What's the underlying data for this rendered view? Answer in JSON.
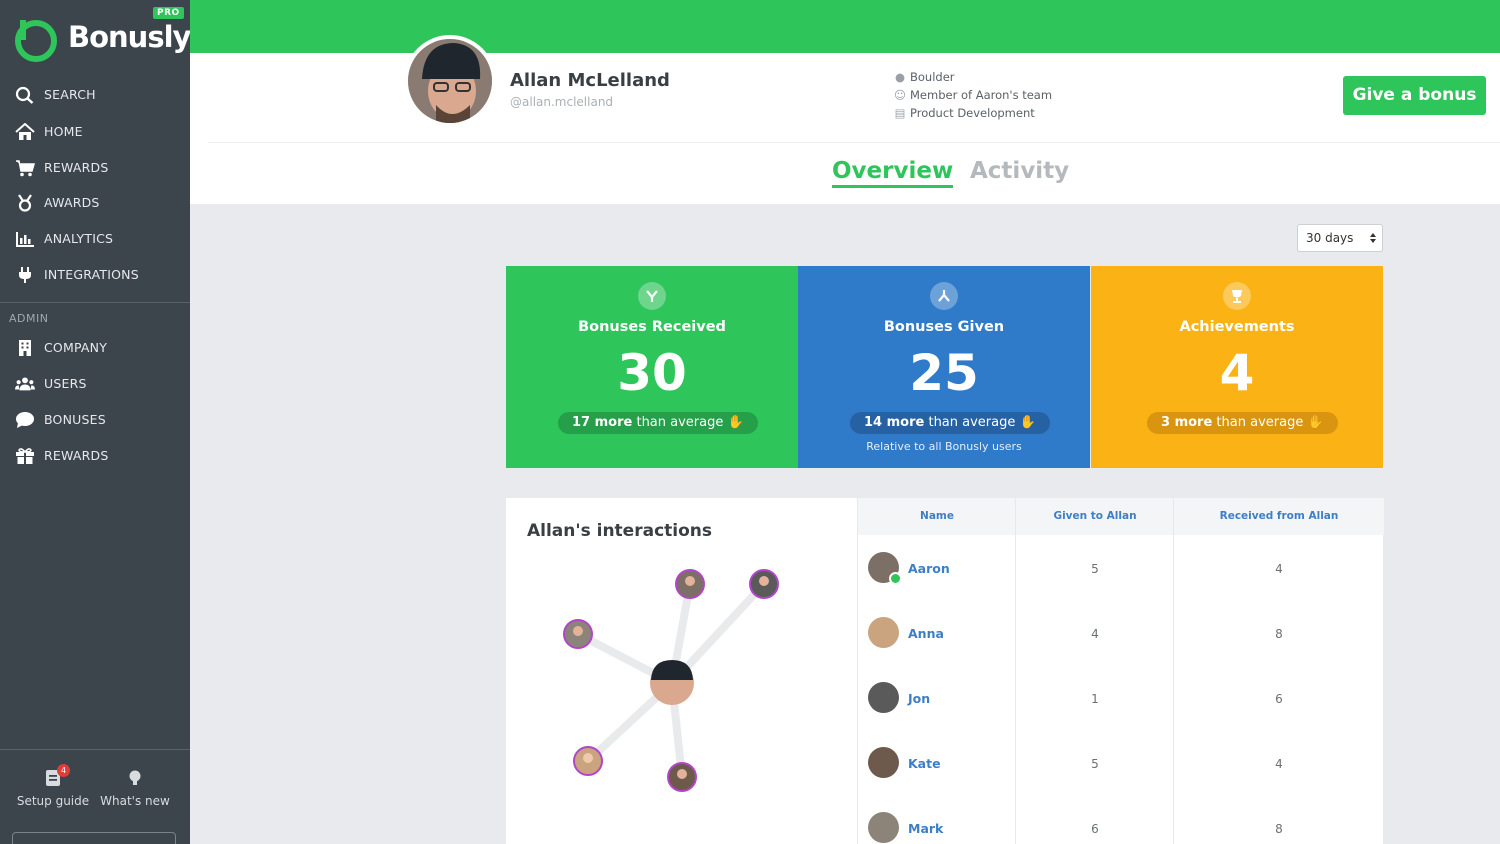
{
  "brand": {
    "name": "Bonusly",
    "badge": "PRO",
    "color": "#2ec55b"
  },
  "sidebar": {
    "items": [
      {
        "label": "SEARCH",
        "icon": "search-icon"
      },
      {
        "label": "HOME",
        "icon": "home-icon"
      },
      {
        "label": "REWARDS",
        "icon": "cart-icon"
      },
      {
        "label": "AWARDS",
        "icon": "medal-icon"
      },
      {
        "label": "ANALYTICS",
        "icon": "bar-chart-icon"
      },
      {
        "label": "INTEGRATIONS",
        "icon": "plug-icon"
      }
    ],
    "admin_label": "ADMIN",
    "admin_items": [
      {
        "label": "COMPANY",
        "icon": "building-icon"
      },
      {
        "label": "USERS",
        "icon": "users-icon"
      },
      {
        "label": "BONUSES",
        "icon": "chat-bubble-icon"
      },
      {
        "label": "REWARDS",
        "icon": "gift-icon"
      }
    ],
    "footer": {
      "setup_label": "Setup guide",
      "setup_badge": "4",
      "whats_new_label": "What's new"
    }
  },
  "profile": {
    "name": "Allan McLelland",
    "handle": "@allan.mclelland",
    "location": "Boulder",
    "team": "Member of Aaron's team",
    "department": "Product Development",
    "give_button": "Give a bonus"
  },
  "tabs": {
    "overview": "Overview",
    "activity": "Activity",
    "active": "Overview"
  },
  "period": {
    "value": "30 days"
  },
  "stats": {
    "received": {
      "title": "Bonuses Received",
      "value": "30",
      "pill_bold": "17 more",
      "pill_rest": "than average",
      "color": "#2ec55b"
    },
    "given": {
      "title": "Bonuses Given",
      "value": "25",
      "pill_bold": "14 more",
      "pill_rest": "than average",
      "note": "Relative to all Bonusly users",
      "color": "#2f7ac9"
    },
    "achievements": {
      "title": "Achievements",
      "value": "4",
      "pill_bold": "3 more",
      "pill_rest": "than average",
      "color": "#fbb215"
    }
  },
  "interactions": {
    "title": "Allan's interactions",
    "columns": {
      "name": "Name",
      "given": "Given to Allan",
      "received": "Received from Allan"
    },
    "rows": [
      {
        "name": "Aaron",
        "given": "5",
        "received": "4"
      },
      {
        "name": "Anna",
        "given": "4",
        "received": "8"
      },
      {
        "name": "Jon",
        "given": "1",
        "received": "6"
      },
      {
        "name": "Kate",
        "given": "5",
        "received": "4"
      },
      {
        "name": "Mark",
        "given": "6",
        "received": "8"
      }
    ]
  }
}
